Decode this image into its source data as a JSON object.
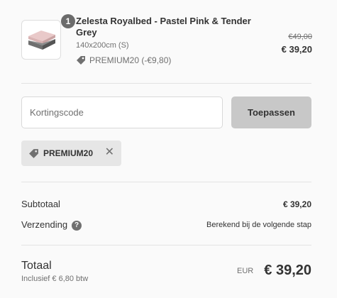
{
  "product": {
    "quantity": "1",
    "name": "Zelesta Royalbed - Pastel Pink & Tender Grey",
    "variant": "140x200cm (S)",
    "discount_label": "PREMIUM20 (-€9,80)",
    "old_price": "€49,00",
    "price": "€ 39,20",
    "image_icon": "bedding-product-image"
  },
  "discount_form": {
    "placeholder": "Kortingscode",
    "apply_label": "Toepassen"
  },
  "applied_code": {
    "code": "PREMIUM20",
    "tag_icon": "tag-icon",
    "remove_icon": "close-icon",
    "remove_glyph": "✕"
  },
  "summary": {
    "subtotal_label": "Subtotaal",
    "subtotal_value": "€ 39,20",
    "shipping_label": "Verzending",
    "shipping_help": "?",
    "shipping_value": "Berekend bij de volgende stap"
  },
  "total": {
    "label": "Totaal",
    "tax_note": "Inclusief € 6,80 btw",
    "currency": "EUR",
    "amount": "€ 39,20"
  },
  "colors": {
    "background": "#fafafa",
    "button": "#c8c8c8",
    "tag": "#e6e6e6",
    "muted_text": "#707070"
  }
}
